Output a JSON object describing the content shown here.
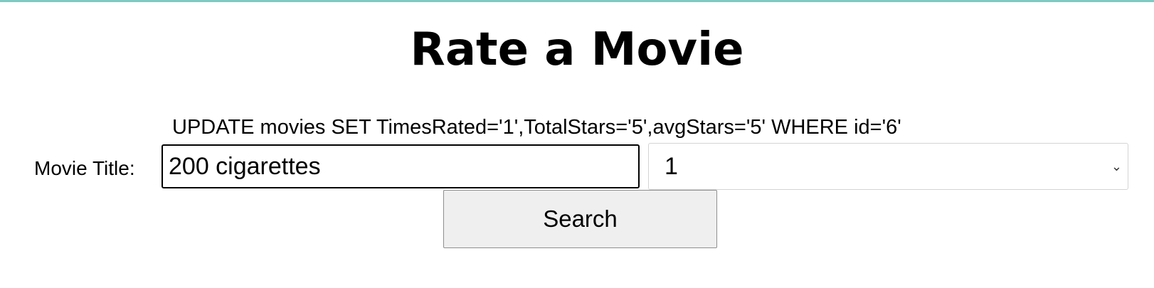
{
  "page": {
    "title": "Rate a Movie",
    "accent_color": "#7ecac3"
  },
  "status": {
    "query": "UPDATE movies SET TimesRated='1',TotalStars='5',avgStars='5' WHERE id='6'"
  },
  "form": {
    "title_label": "Movie Title:",
    "title_value": "200 cigarettes",
    "rating_selected": "1",
    "rating_chevron_icon": "chevron-down-icon",
    "search_label": "Search"
  }
}
